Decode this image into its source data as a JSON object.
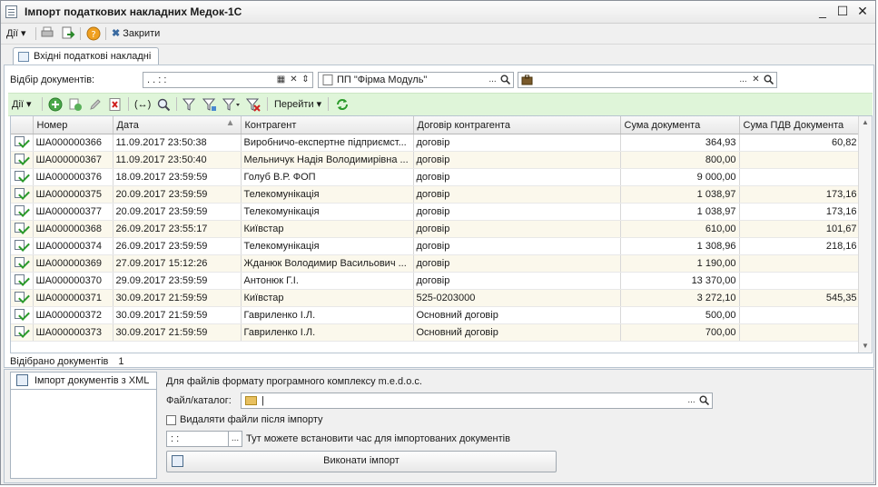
{
  "window": {
    "title": "Імпорт податкових накладних Медок-1С",
    "controls": [
      "_",
      "☐",
      "✕"
    ]
  },
  "menubar": {
    "actions_label": "Дії",
    "close_label": "Закрити"
  },
  "tab": {
    "label": "Вхідні податкові накладні"
  },
  "filter": {
    "label": "Відбір документів:",
    "period_value": ". .      : :",
    "org_value": "ПП \"Фірма Модуль\"",
    "contractor_value": ""
  },
  "toolbar": {
    "actions_label": "Дії",
    "goto_label": "Перейти"
  },
  "table": {
    "columns": [
      "Номер",
      "Дата",
      "Контрагент",
      "Договір контрагента",
      "Сума документа",
      "Сума ПДВ Документа"
    ],
    "rows": [
      {
        "num": "ША000000366",
        "date": "11.09.2017 23:50:38",
        "contr": "Виробничо-експертне підприємст...",
        "dog": "договір",
        "sum": "364,93",
        "vat": "60,82"
      },
      {
        "num": "ША000000367",
        "date": "11.09.2017 23:50:40",
        "contr": "Мельничук Надія Володимирівна ...",
        "dog": "договір",
        "sum": "800,00",
        "vat": ""
      },
      {
        "num": "ША000000376",
        "date": "18.09.2017 23:59:59",
        "contr": "Голуб В.Р. ФОП",
        "dog": "договір",
        "sum": "9 000,00",
        "vat": ""
      },
      {
        "num": "ША000000375",
        "date": "20.09.2017 23:59:59",
        "contr": "Телекомунікація",
        "dog": "договір",
        "sum": "1 038,97",
        "vat": "173,16"
      },
      {
        "num": "ША000000377",
        "date": "20.09.2017 23:59:59",
        "contr": "Телекомунікація",
        "dog": "договір",
        "sum": "1 038,97",
        "vat": "173,16"
      },
      {
        "num": "ША000000368",
        "date": "26.09.2017 23:55:17",
        "contr": "Київстар",
        "dog": "договір",
        "sum": "610,00",
        "vat": "101,67"
      },
      {
        "num": "ША000000374",
        "date": "26.09.2017 23:59:59",
        "contr": "Телекомунікація",
        "dog": "договір",
        "sum": "1 308,96",
        "vat": "218,16"
      },
      {
        "num": "ША000000369",
        "date": "27.09.2017 15:12:26",
        "contr": "Жданюк Володимир Васильович ...",
        "dog": "договір",
        "sum": "1 190,00",
        "vat": ""
      },
      {
        "num": "ША000000370",
        "date": "29.09.2017 23:59:59",
        "contr": "Антонюк Г.І.",
        "dog": "договір",
        "sum": "13 370,00",
        "vat": ""
      },
      {
        "num": "ША000000371",
        "date": "30.09.2017 21:59:59",
        "contr": "Київстар",
        "dog": "525-0203000",
        "sum": "3 272,10",
        "vat": "545,35"
      },
      {
        "num": "ША000000372",
        "date": "30.09.2017 21:59:59",
        "contr": "Гавриленко І.Л.",
        "dog": "Основний договір",
        "sum": "500,00",
        "vat": ""
      },
      {
        "num": "ША000000373",
        "date": "30.09.2017 21:59:59",
        "contr": "Гавриленко І.Л.",
        "dog": "Основний договір",
        "sum": "700,00",
        "vat": ""
      }
    ]
  },
  "status": {
    "label": "Відібрано документів",
    "count": "1"
  },
  "import": {
    "tab_label": "Імпорт документів з XML",
    "hint": "Для файлів формату програмного комплексу m.e.d.o.c.",
    "file_label": "Файл/каталог:",
    "file_value": "",
    "delete_label": "Видаляти файли після імпорту",
    "time_value": ": :",
    "time_hint": "Тут можете встановити час для імпортованих документів",
    "exec_label": "Виконати імпорт"
  },
  "icons": [
    "document-icon",
    "printer-icon",
    "export-icon",
    "help-icon",
    "close-icon",
    "calendar-icon",
    "search-icon",
    "folder-icon",
    "add-icon",
    "copy-icon",
    "edit-icon",
    "delete-icon",
    "filter-icon",
    "refresh-icon"
  ]
}
